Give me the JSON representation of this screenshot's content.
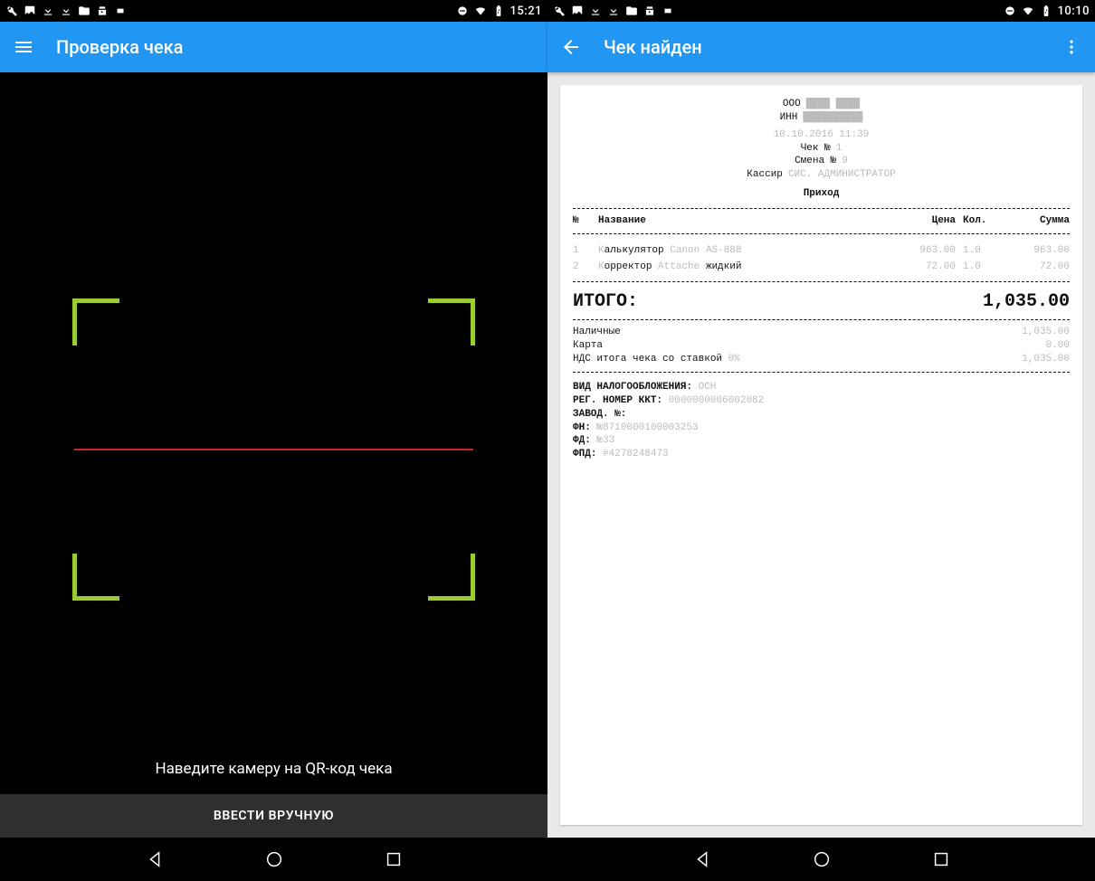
{
  "left": {
    "status_time": "15:21",
    "app_title": "Проверка чека",
    "hint": "Наведите камеру на QR-код чека",
    "manual_button": "ВВЕСТИ ВРУЧНУЮ"
  },
  "right": {
    "status_time": "10:10",
    "app_title": "Чек найден",
    "receipt": {
      "org_label": "ООО",
      "inn_label": "ИНН",
      "datetime": "10.10.2016 11:39",
      "check_no_label": "Чек №",
      "check_no": "1",
      "shift_label": "Смена №",
      "shift_no": "9",
      "cashier_label": "Кассир",
      "cashier_value": "СИС. АДМИНИСТРАТОР",
      "operation": "Приход",
      "headers": {
        "num": "№",
        "name": "Название",
        "price": "Цена",
        "qty": "Кол.",
        "sum": "Сумма"
      },
      "items": [
        {
          "num": "1",
          "name_k": "К",
          "name_rest_black": "алькулятор",
          "name_grey": "Canon AS-888",
          "price": "963.00",
          "qty": "1.0",
          "sum": "963.00"
        },
        {
          "num": "2",
          "name_k": "К",
          "name_rest_black": "орректор",
          "name_grey": "Attache",
          "name_tail_black": "жидкий",
          "price": "72.00",
          "qty": "1.0",
          "sum": "72.00"
        }
      ],
      "total_label": "ИТОГО:",
      "total_value": "1,035.00",
      "payments": [
        {
          "label": "Наличные",
          "value": "1,035.00"
        },
        {
          "label": "Карта",
          "value": "0.00"
        },
        {
          "label": "НДС итога чека со ставкой",
          "rate": "0%",
          "value": "1,035.00"
        }
      ],
      "footer": [
        {
          "label": "ВИД НАЛОГООБЛОЖЕНИЯ:",
          "value": "ОСН"
        },
        {
          "label": "РЕГ. НОМЕР ККТ:",
          "value": "0000000006002082"
        },
        {
          "label": "ЗАВОД. №:",
          "value": ""
        },
        {
          "label": "ФН:",
          "value": "№8710000100003253"
        },
        {
          "label": "ФД:",
          "value": "№33"
        },
        {
          "label": "ФПД:",
          "value": "#4278248473"
        }
      ]
    }
  }
}
